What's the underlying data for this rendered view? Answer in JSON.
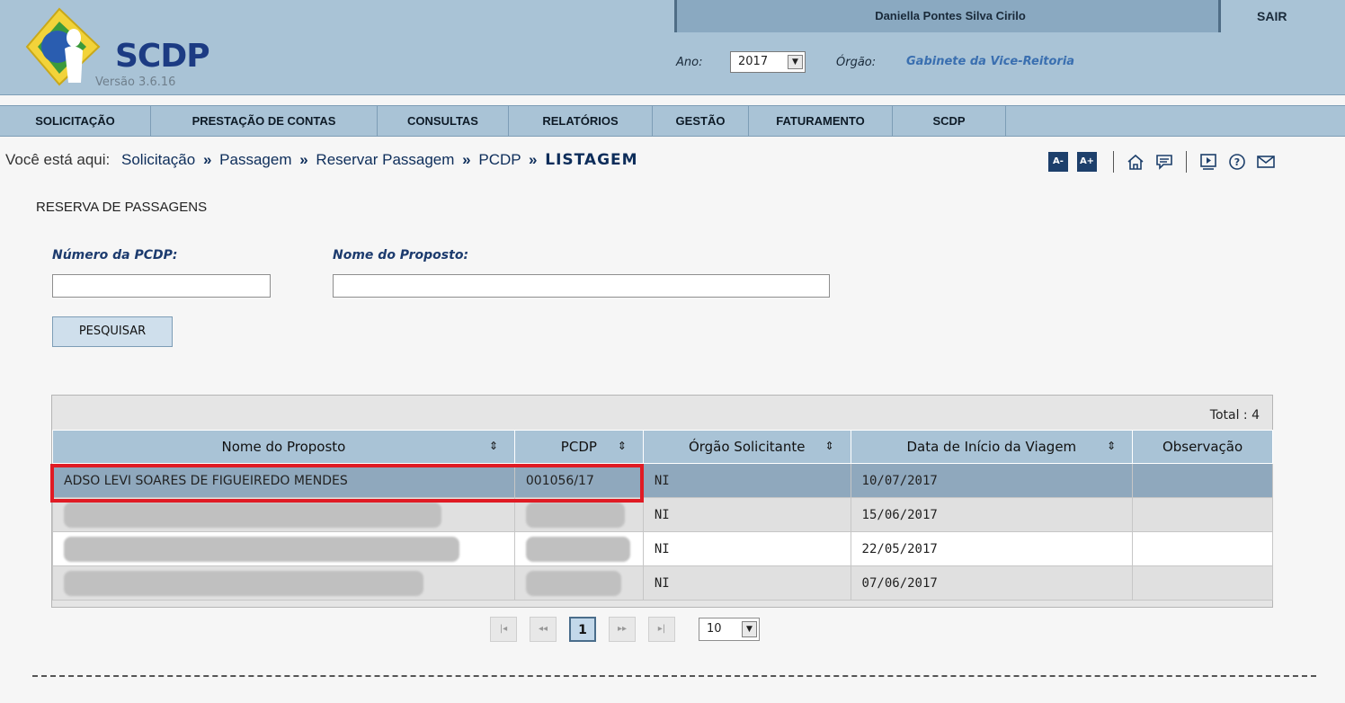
{
  "header": {
    "app_name": "SCDP",
    "version": "Versão 3.6.16",
    "user_name": "Daniella Pontes Silva Cirilo",
    "logout_label": "SAIR",
    "year_label": "Ano:",
    "year_value": "2017",
    "org_label": "Órgão:",
    "org_value": "Gabinete da Vice-Reitoria"
  },
  "menu": [
    {
      "label": "SOLICITAÇÃO"
    },
    {
      "label": "PRESTAÇÃO DE CONTAS"
    },
    {
      "label": "CONSULTAS"
    },
    {
      "label": "RELATÓRIOS"
    },
    {
      "label": "GESTÃO"
    },
    {
      "label": "FATURAMENTO"
    },
    {
      "label": "SCDP"
    }
  ],
  "breadcrumb": {
    "prefix": "Você está aqui:",
    "items": [
      "Solicitação",
      "Passagem",
      "Reservar Passagem",
      "PCDP"
    ],
    "current": "LISTAGEM"
  },
  "tools": {
    "font_decrease": "A-",
    "font_increase": "A+",
    "icons": [
      "home-icon",
      "chat-icon",
      "video-icon",
      "help-icon",
      "mail-icon"
    ]
  },
  "page": {
    "title": "RESERVA DE PASSAGENS",
    "pcdp_label": "Número da PCDP:",
    "pcdp_value": "",
    "name_label": "Nome do Proposto:",
    "name_value": "",
    "search_button": "PESQUISAR"
  },
  "table": {
    "total_text": "Total : 4",
    "columns": [
      "Nome do Proposto",
      "PCDP",
      "Órgão Solicitante",
      "Data de Início da Viagem",
      "Observação"
    ],
    "rows": [
      {
        "name": "ADSO LEVI SOARES DE FIGUEIREDO MENDES",
        "pcdp": "001056/17",
        "orgao": "NI",
        "data": "10/07/2017",
        "obs": ""
      },
      {
        "name": "",
        "pcdp": "",
        "orgao": "NI",
        "data": "15/06/2017",
        "obs": ""
      },
      {
        "name": "",
        "pcdp": "",
        "orgao": "NI",
        "data": "22/05/2017",
        "obs": ""
      },
      {
        "name": "",
        "pcdp": "",
        "orgao": "NI",
        "data": "07/06/2017",
        "obs": ""
      }
    ]
  },
  "pagination": {
    "first": "|◂",
    "prev": "◂◂",
    "current_page": "1",
    "next": "▸▸",
    "last": "▸|",
    "page_size": "10"
  },
  "colors": {
    "header_bg": "#a9c3d6",
    "highlight": "#e01b24",
    "selected_row": "#8fa8bd"
  }
}
